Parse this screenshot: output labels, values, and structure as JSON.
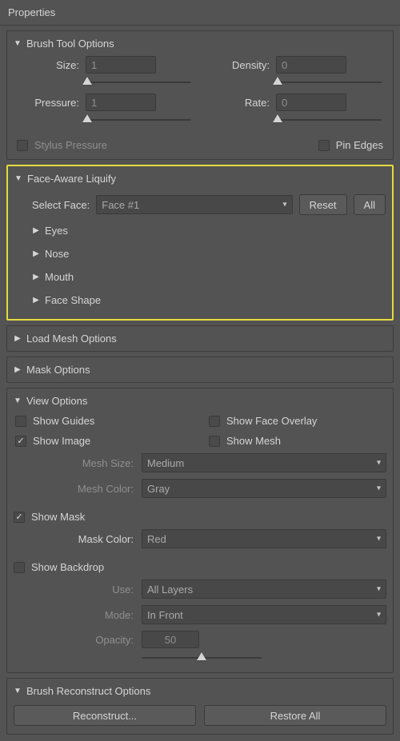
{
  "panelTitle": "Properties",
  "brushTool": {
    "title": "Brush Tool Options",
    "sizeLabel": "Size:",
    "sizeValue": "1",
    "densityLabel": "Density:",
    "densityValue": "0",
    "pressureLabel": "Pressure:",
    "pressureValue": "1",
    "rateLabel": "Rate:",
    "rateValue": "0",
    "stylusLabel": "Stylus Pressure",
    "pinEdgesLabel": "Pin Edges"
  },
  "faceAware": {
    "title": "Face-Aware Liquify",
    "selectFaceLabel": "Select Face:",
    "selectedFace": "Face #1",
    "resetLabel": "Reset",
    "allLabel": "All",
    "subs": {
      "eyes": "Eyes",
      "nose": "Nose",
      "mouth": "Mouth",
      "faceShape": "Face Shape"
    }
  },
  "loadMesh": {
    "title": "Load Mesh Options"
  },
  "maskOptions": {
    "title": "Mask Options"
  },
  "viewOptions": {
    "title": "View Options",
    "showGuides": "Show Guides",
    "showFaceOverlay": "Show Face Overlay",
    "showImage": "Show Image",
    "showMesh": "Show Mesh",
    "meshSizeLabel": "Mesh Size:",
    "meshSizeValue": "Medium",
    "meshColorLabel": "Mesh Color:",
    "meshColorValue": "Gray",
    "showMask": "Show Mask",
    "maskColorLabel": "Mask Color:",
    "maskColorValue": "Red",
    "showBackdrop": "Show Backdrop",
    "useLabel": "Use:",
    "useValue": "All Layers",
    "modeLabel": "Mode:",
    "modeValue": "In Front",
    "opacityLabel": "Opacity:",
    "opacityValue": "50"
  },
  "reconstruct": {
    "title": "Brush Reconstruct Options",
    "reconstructBtn": "Reconstruct...",
    "restoreBtn": "Restore All"
  }
}
